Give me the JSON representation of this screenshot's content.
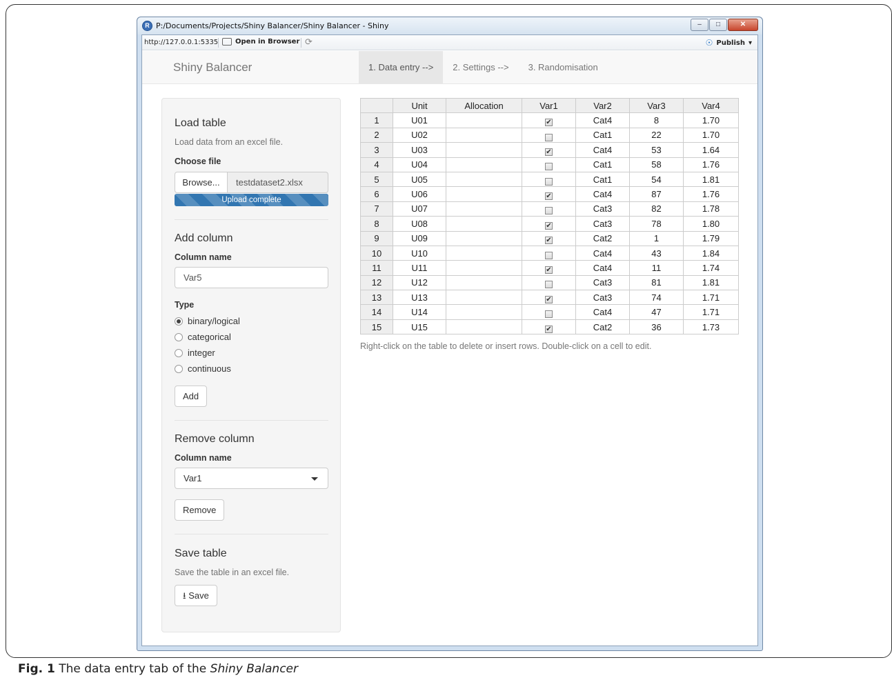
{
  "window": {
    "title": "P:/Documents/Projects/Shiny Balancer/Shiny Balancer - Shiny",
    "url": "http://127.0.0.1:5335",
    "open_in_browser": "Open in Browser",
    "publish": "Publish"
  },
  "navbar": {
    "brand": "Shiny Balancer",
    "tabs": [
      "1. Data entry -->",
      "2. Settings -->",
      "3. Randomisation"
    ]
  },
  "sidebar": {
    "load": {
      "heading": "Load table",
      "help": "Load data from an excel file.",
      "label": "Choose file",
      "browse": "Browse...",
      "filename": "testdataset2.xlsx",
      "progress": "Upload complete",
      "progress_fraction": 1.0
    },
    "add": {
      "heading": "Add column",
      "name_label": "Column name",
      "name_value": "Var5",
      "type_label": "Type",
      "types": [
        "binary/logical",
        "categorical",
        "integer",
        "continuous"
      ],
      "selected_type": "binary/logical",
      "button": "Add"
    },
    "remove": {
      "heading": "Remove column",
      "name_label": "Column name",
      "selected": "Var1",
      "button": "Remove"
    },
    "save": {
      "heading": "Save table",
      "help": "Save the table in an excel file.",
      "button": "Save"
    }
  },
  "table": {
    "headers": [
      "",
      "Unit",
      "Allocation",
      "Var1",
      "Var2",
      "Var3",
      "Var4"
    ],
    "rows": [
      {
        "n": "1",
        "unit": "U01",
        "alloc": "",
        "var1": true,
        "var2": "Cat4",
        "var3": "8",
        "var4": "1.70"
      },
      {
        "n": "2",
        "unit": "U02",
        "alloc": "",
        "var1": false,
        "var2": "Cat1",
        "var3": "22",
        "var4": "1.70"
      },
      {
        "n": "3",
        "unit": "U03",
        "alloc": "",
        "var1": true,
        "var2": "Cat4",
        "var3": "53",
        "var4": "1.64"
      },
      {
        "n": "4",
        "unit": "U04",
        "alloc": "",
        "var1": false,
        "var2": "Cat1",
        "var3": "58",
        "var4": "1.76"
      },
      {
        "n": "5",
        "unit": "U05",
        "alloc": "",
        "var1": false,
        "var2": "Cat1",
        "var3": "54",
        "var4": "1.81"
      },
      {
        "n": "6",
        "unit": "U06",
        "alloc": "",
        "var1": true,
        "var2": "Cat4",
        "var3": "87",
        "var4": "1.76"
      },
      {
        "n": "7",
        "unit": "U07",
        "alloc": "",
        "var1": false,
        "var2": "Cat3",
        "var3": "82",
        "var4": "1.78"
      },
      {
        "n": "8",
        "unit": "U08",
        "alloc": "",
        "var1": true,
        "var2": "Cat3",
        "var3": "78",
        "var4": "1.80"
      },
      {
        "n": "9",
        "unit": "U09",
        "alloc": "",
        "var1": true,
        "var2": "Cat2",
        "var3": "1",
        "var4": "1.79"
      },
      {
        "n": "10",
        "unit": "U10",
        "alloc": "",
        "var1": false,
        "var2": "Cat4",
        "var3": "43",
        "var4": "1.84"
      },
      {
        "n": "11",
        "unit": "U11",
        "alloc": "",
        "var1": true,
        "var2": "Cat4",
        "var3": "11",
        "var4": "1.74"
      },
      {
        "n": "12",
        "unit": "U12",
        "alloc": "",
        "var1": false,
        "var2": "Cat3",
        "var3": "81",
        "var4": "1.81"
      },
      {
        "n": "13",
        "unit": "U13",
        "alloc": "",
        "var1": true,
        "var2": "Cat3",
        "var3": "74",
        "var4": "1.71"
      },
      {
        "n": "14",
        "unit": "U14",
        "alloc": "",
        "var1": false,
        "var2": "Cat4",
        "var3": "47",
        "var4": "1.71"
      },
      {
        "n": "15",
        "unit": "U15",
        "alloc": "",
        "var1": true,
        "var2": "Cat2",
        "var3": "36",
        "var4": "1.73"
      }
    ],
    "note": "Right-click on the table to delete or insert rows. Double-click on a cell to edit."
  },
  "caption": {
    "label": "Fig. 1",
    "text_before": " The data entry tab of the ",
    "text_italic": "Shiny Balancer"
  }
}
